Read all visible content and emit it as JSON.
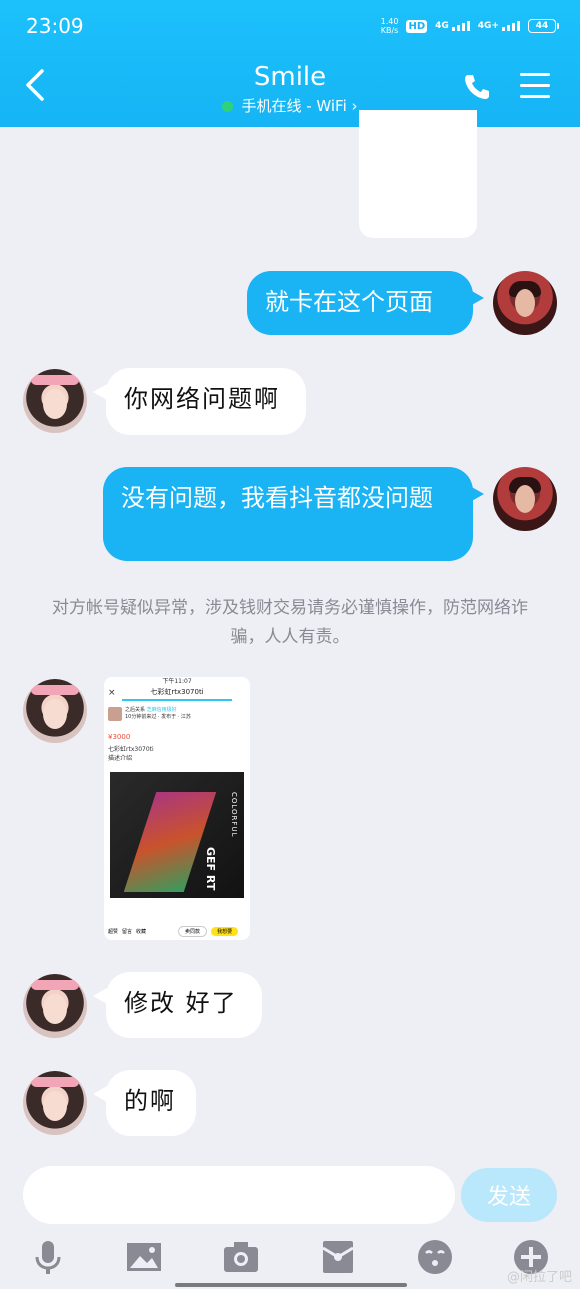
{
  "status_bar": {
    "time": "23:09",
    "net_speed_value": "1.40",
    "net_speed_unit": "KB/s",
    "hd": "HD",
    "sim1_type": "4G",
    "sim2_type": "4G+",
    "battery": "44"
  },
  "header": {
    "title": "Smile",
    "status": "手机在线 - WiFi",
    "status_chevron": "›",
    "online_color": "#2fd27a"
  },
  "messages": [
    {
      "side": "out",
      "text": "就卡在这个页面"
    },
    {
      "side": "in",
      "text": "你网络问题啊"
    },
    {
      "side": "out",
      "text": "没有问题，我看抖音都没问题"
    },
    {
      "side": "system",
      "text": "对方帐号疑似异常，涉及钱财交易请务必谨慎操作，防范网络诈骗，人人有责。"
    },
    {
      "side": "in",
      "type": "image"
    },
    {
      "side": "in",
      "text": "修改 好了"
    },
    {
      "side": "in",
      "text": "的啊"
    }
  ],
  "shared_screenshot": {
    "status_time": "下午11:07",
    "close": "×",
    "title": "七彩虹rtx3070ti",
    "seller_name": "之后关系",
    "seller_badge": "芝麻信用极好",
    "seller_sub": "10分钟前来过 · 发布于 · 江苏",
    "price": "¥3000",
    "item_name": "七彩虹rtx3070ti",
    "item_desc": "描述介绍",
    "photo_brand": "COLORFUL",
    "photo_gpu": "GEF RT",
    "like": "超赞",
    "comment": "留言",
    "favorite": "收藏",
    "ask_btn": "卖同款",
    "want_btn": "我想要"
  },
  "input": {
    "placeholder": "",
    "send_label": "发送"
  },
  "toolbar": {
    "items": [
      "mic-icon",
      "picture-icon",
      "camera-icon",
      "red-packet-icon",
      "emoji-icon",
      "plus-icon"
    ]
  },
  "watermark": "@闲拉了吧",
  "theme": {
    "accent": "#1ab3f4",
    "chat_bg": "#eeeef5"
  }
}
